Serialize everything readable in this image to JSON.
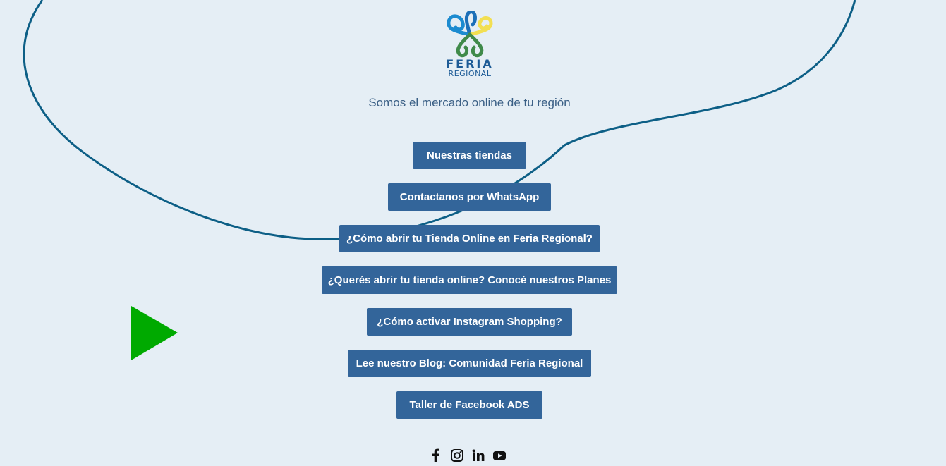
{
  "logo": {
    "line1": "FERIA",
    "line2": "REGIONAL"
  },
  "tagline": "Somos el mercado online de tu región",
  "buttons": [
    "Nuestras tiendas",
    "Contactanos por WhatsApp",
    "¿Cómo abrir tu Tienda Online en Feria Regional?",
    "¿Querés abrir tu tienda online? Conocé nuestros Planes",
    "¿Cómo activar Instagram Shopping?",
    "Lee nuestro Blog: Comunidad Feria Regional",
    "Taller de Facebook ADS"
  ],
  "social": [
    "facebook-icon",
    "instagram-icon",
    "linkedin-icon",
    "youtube-icon"
  ],
  "colors": {
    "background": "#e5eef5",
    "button": "#33659a",
    "curve": "#0d5f86",
    "play": "#00aa00",
    "tagline": "#3a5f85"
  }
}
